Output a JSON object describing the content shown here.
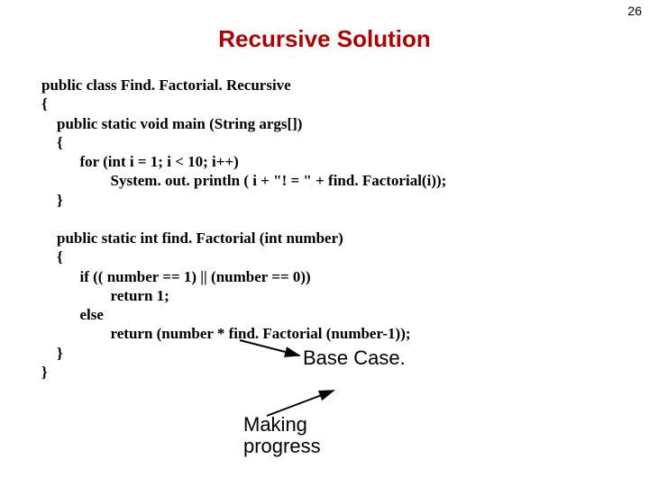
{
  "page_number": "26",
  "title": "Recursive Solution",
  "code": {
    "l1": "public class Find. Factorial. Recursive",
    "l2": "{",
    "l3": "    public static void main (String args[])",
    "l4": "    {",
    "l5": "          for (int i = 1; i < 10; i++)",
    "l6": "                  System. out. println ( i + \"! = \" + find. Factorial(i));",
    "l7": "    }",
    "l8": "",
    "l9": "    public static int find. Factorial (int number)",
    "l10": "    {",
    "l11": "          if (( number == 1) || (number == 0))",
    "l12": "                  return 1;",
    "l13": "          else",
    "l14": "                  return (number * find. Factorial (number-1));",
    "l15": "    }",
    "l16": "}"
  },
  "annotations": {
    "base_case": "Base Case.",
    "making_progress": "Making\nprogress"
  }
}
